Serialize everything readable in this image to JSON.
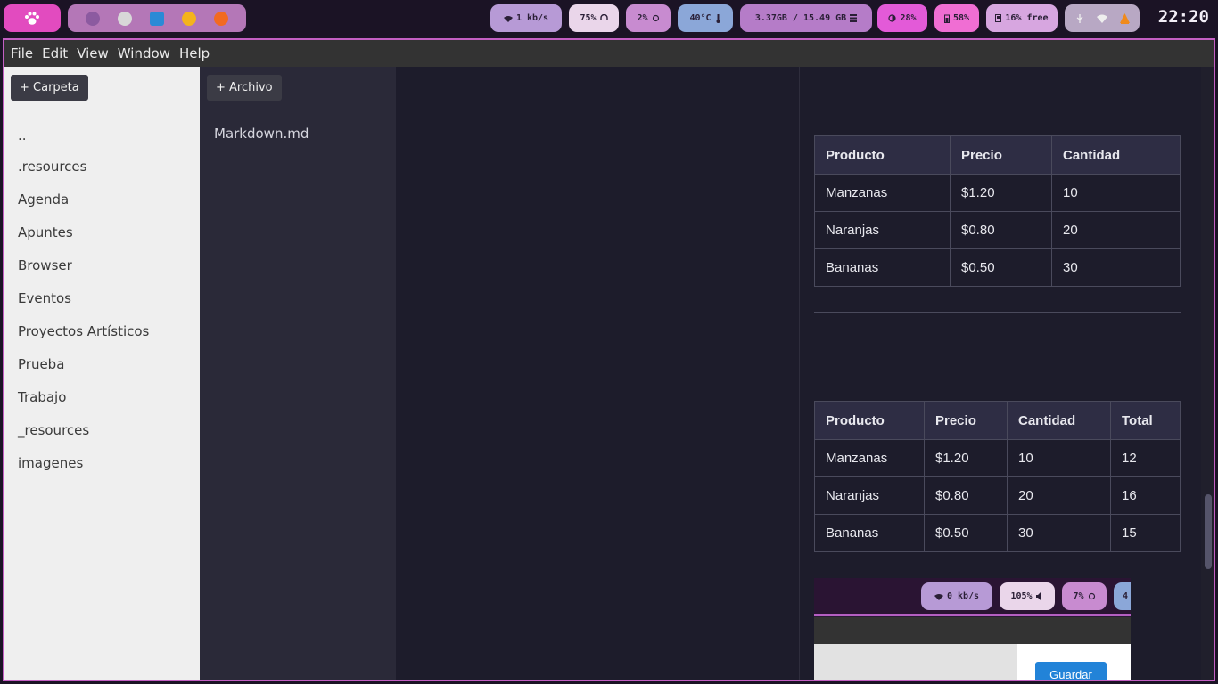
{
  "topbar": {
    "network": "1 kb/s",
    "volume": "75%",
    "cpu": "2%",
    "temperature": "40°C",
    "memory": "3.37GB / 15.49 GB",
    "brightness": "28%",
    "battery": "58%",
    "disk": "16% free",
    "clock": "22:20"
  },
  "menu": [
    "File",
    "Edit",
    "Window",
    "Help"
  ],
  "menu_view": "View",
  "folders": {
    "new_label": "+ Carpeta",
    "items": [
      "..",
      ".resources",
      "Agenda",
      "Apuntes",
      "Browser",
      "Eventos",
      "Proyectos Artísticos",
      "Prueba",
      "Trabajo",
      "_resources",
      "imagenes"
    ]
  },
  "files": {
    "new_label": "+ Archivo",
    "items": [
      "Markdown.md"
    ]
  },
  "preview": {
    "table1": {
      "headers": [
        "Producto",
        "Precio",
        "Cantidad"
      ],
      "rows": [
        [
          "Manzanas",
          "$1.20",
          "10"
        ],
        [
          "Naranjas",
          "$0.80",
          "20"
        ],
        [
          "Bananas",
          "$0.50",
          "30"
        ]
      ]
    },
    "table2": {
      "headers": [
        "Producto",
        "Precio",
        "Cantidad",
        "Total"
      ],
      "rows": [
        [
          "Manzanas",
          "$1.20",
          "10",
          "12"
        ],
        [
          "Naranjas",
          "$0.80",
          "20",
          "16"
        ],
        [
          "Bananas",
          "$0.50",
          "30",
          "15"
        ]
      ]
    },
    "embedded_image": {
      "network": "0 kb/s",
      "volume": "105%",
      "cpu": "7%",
      "partial": "4",
      "save_label": "Guardar"
    }
  }
}
